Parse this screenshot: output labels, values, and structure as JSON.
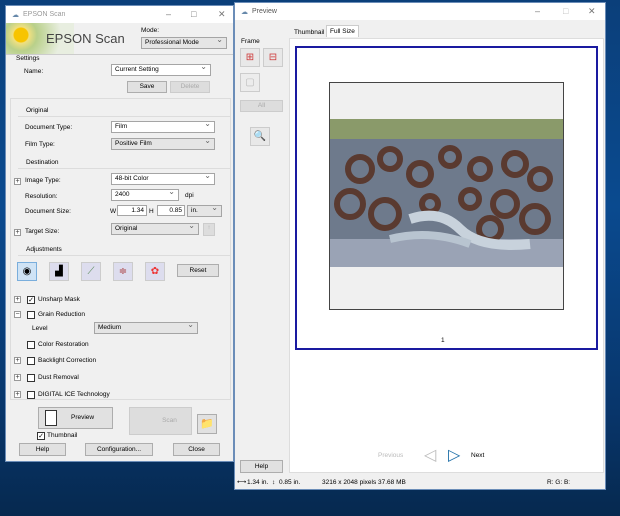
{
  "scan_window": {
    "title": "EPSON Scan",
    "logo_text": "EPSON Scan",
    "mode_label": "Mode:",
    "mode_value": "Professional Mode",
    "settings": {
      "heading": "Settings",
      "name_label": "Name:",
      "name_value": "Current Setting",
      "save": "Save",
      "delete": "Delete"
    },
    "original": {
      "heading": "Original",
      "doc_type_label": "Document Type:",
      "doc_type_value": "Film",
      "film_type_label": "Film Type:",
      "film_type_value": "Positive Film"
    },
    "destination": {
      "heading": "Destination",
      "image_type_label": "Image Type:",
      "image_type_value": "48-bit Color",
      "resolution_label": "Resolution:",
      "resolution_value": "2400",
      "resolution_unit": "dpi",
      "doc_size_label": "Document Size:",
      "w_label": "W",
      "w_value": "1.34",
      "h_label": "H",
      "h_value": "0.85",
      "unit_value": "in.",
      "target_size_label": "Target Size:",
      "target_size_value": "Original"
    },
    "adjustments": {
      "heading": "Adjustments",
      "reset": "Reset",
      "unsharp_mask": "Unsharp Mask",
      "unsharp_checked": true,
      "grain_reduction": "Grain Reduction",
      "grain_checked": false,
      "level_label": "Level",
      "level_value": "Medium",
      "color_restoration": "Color Restoration",
      "backlight": "Backlight Correction",
      "dust": "Dust Removal",
      "ice": "DIGITAL ICE Technology"
    },
    "preview_btn": "Preview",
    "scan_btn": "Scan",
    "thumbnail_label": "Thumbnail",
    "thumbnail_checked": true,
    "help": "Help",
    "configuration": "Configuration...",
    "close": "Close"
  },
  "preview_window": {
    "title": "Preview",
    "tabs": [
      "Thumbnail",
      "Full Size"
    ],
    "active_tab": "Full Size",
    "frame_label": "Frame",
    "all_btn": "All",
    "page_number": "1",
    "previous": "Previous",
    "next": "Next",
    "help": "Help",
    "status": {
      "width": "1.34 in.",
      "height": "0.85 in.",
      "pixels": "3216 x 2048 pixels 37.68 MB",
      "rgb": "R: G: B:"
    }
  },
  "colors": {
    "selection_border": "#1a1aa0",
    "accent": "#1e6fa8"
  }
}
